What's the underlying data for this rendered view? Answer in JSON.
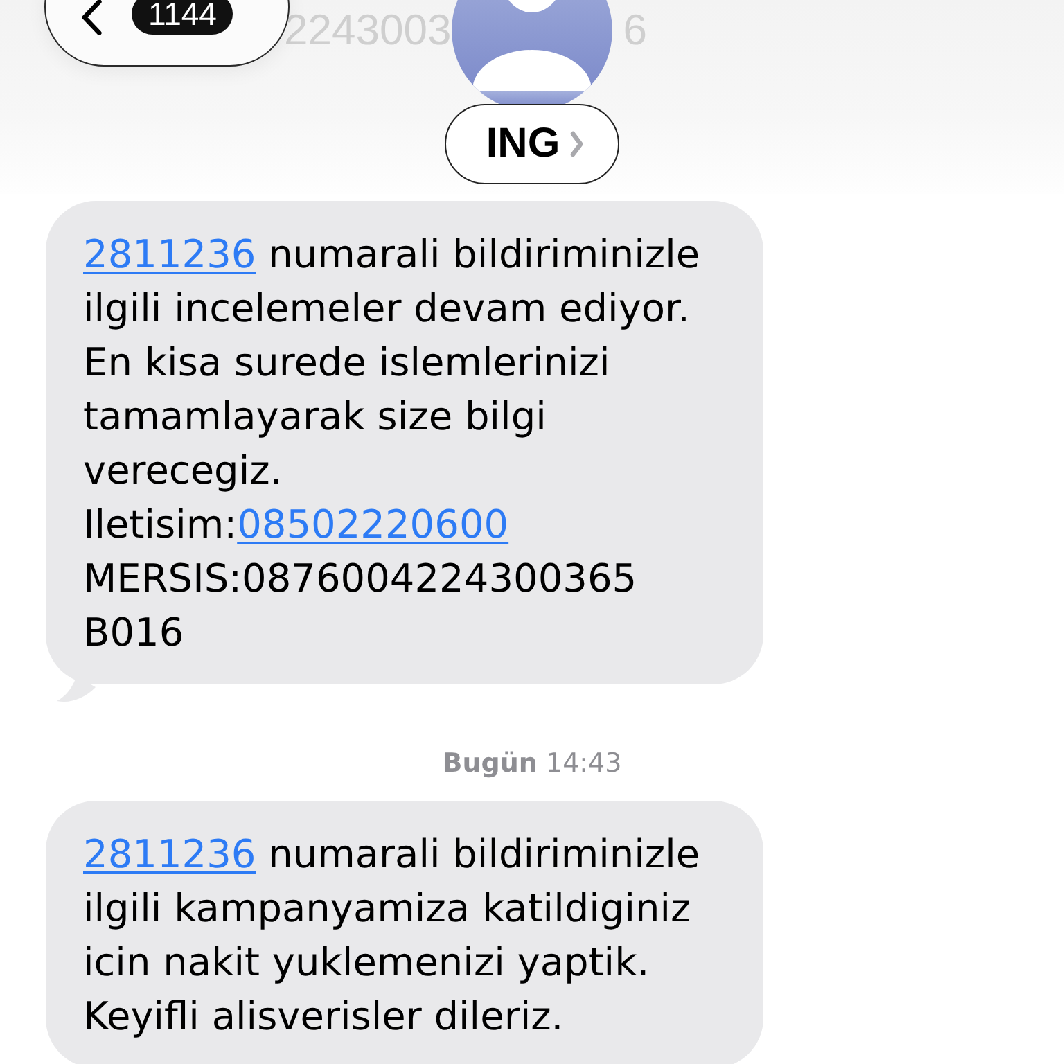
{
  "header": {
    "behind_text": [
      "2243003",
      "6"
    ],
    "back_button": {
      "badge": "1144"
    },
    "contact": {
      "name": "ING"
    }
  },
  "thread": [
    {
      "kind": "message",
      "tail": true,
      "segments": [
        {
          "kind": "link",
          "text": "2811236"
        },
        {
          "kind": "text",
          "text": " numarali bildiriminizle ilgili incelemeler devam ediyor. En kisa surede islemlerinizi tamamlayarak size bilgi verecegiz.\nIletisim:"
        },
        {
          "kind": "link",
          "text": "08502220600"
        },
        {
          "kind": "text",
          "text": "\nMERSIS:0876004224300365 B016"
        }
      ]
    },
    {
      "kind": "timestamp",
      "text": "**Bugün** 14:43"
    },
    {
      "kind": "message",
      "tail": false,
      "segments": [
        {
          "kind": "link",
          "text": "2811236"
        },
        {
          "kind": "text",
          "text": " numarali bildiriminizle ilgili kampanyamiza katildiginiz icin nakit yuklemenizi yaptik. Keyifli alisverisler dileriz."
        }
      ]
    }
  ]
}
